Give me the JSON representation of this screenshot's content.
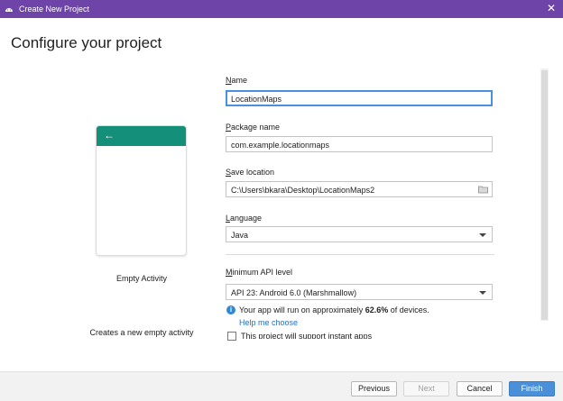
{
  "window": {
    "title": "Create New Project",
    "close_glyph": "✕",
    "app_icon": "android-icon"
  },
  "page": {
    "title": "Configure your project"
  },
  "template": {
    "name": "Empty Activity",
    "description": "Creates a new empty activity",
    "back_glyph": "←",
    "bar_color": "#14907a"
  },
  "form": {
    "name": {
      "label": "Name",
      "value": "LocationMaps"
    },
    "package": {
      "label": "Package name",
      "value": "com.example.locationmaps"
    },
    "save_location": {
      "label": "Save location",
      "value": "C:\\Users\\bkara\\Desktop\\LocationMaps2",
      "icon": "folder-icon"
    },
    "language": {
      "label": "Language",
      "value": "Java"
    },
    "min_api": {
      "label": "Minimum API level",
      "value": "API 23: Android 6.0 (Marshmallow)"
    },
    "api_info": {
      "prefix": "Your app will run on approximately ",
      "percent": "62.6%",
      "suffix": " of devices.",
      "help_link": "Help me choose",
      "icon_glyph": "i"
    },
    "instant_apps": {
      "label": "This project will support instant apps",
      "checked": false
    }
  },
  "buttons": {
    "previous": "Previous",
    "next": "Next",
    "cancel": "Cancel",
    "finish": "Finish"
  },
  "colors": {
    "titlebar": "#6f44a8",
    "accent": "#4a90d9",
    "link": "#2a6ec7",
    "info": "#2d88d8"
  }
}
